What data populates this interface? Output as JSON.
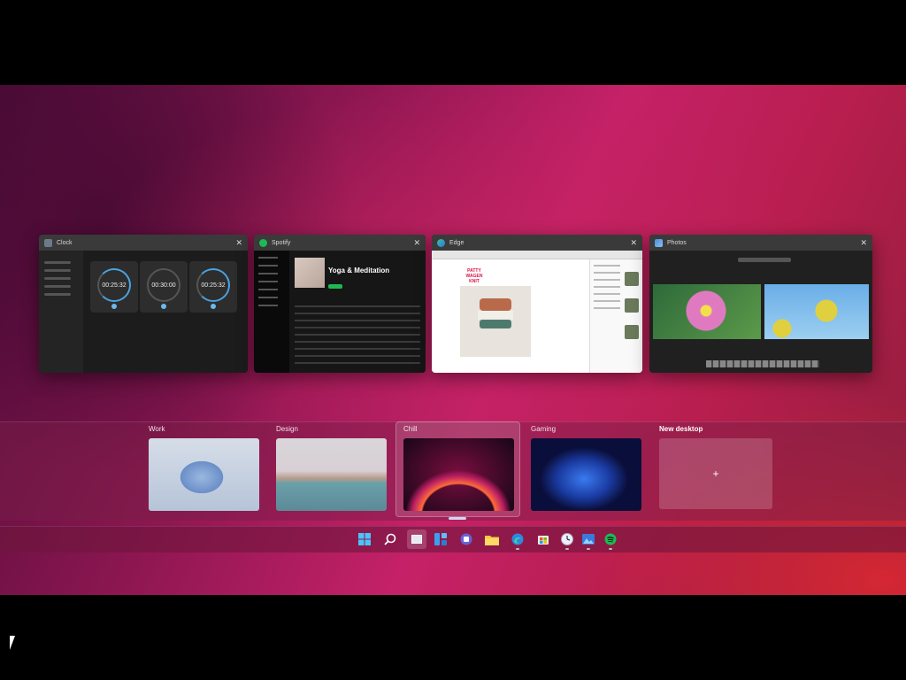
{
  "windows": [
    {
      "title": "Clock",
      "timers": [
        "00:25:32",
        "00:30:00",
        "00:25:32"
      ]
    },
    {
      "title": "Spotify",
      "playlist": "Yoga & Meditation"
    },
    {
      "title": "Edge",
      "logo": "PATTY WAGEN KNIT"
    },
    {
      "title": "Photos"
    }
  ],
  "desktops": [
    {
      "label": "Work"
    },
    {
      "label": "Design"
    },
    {
      "label": "Chill",
      "active": true
    },
    {
      "label": "Gaming"
    },
    {
      "label": "New desktop",
      "icon": "+"
    }
  ],
  "taskbar": {
    "icons": [
      "windows-start-icon",
      "search-icon",
      "task-view-icon",
      "widgets-icon",
      "teams-chat-icon",
      "edge-icon",
      "file-explorer-icon",
      "store-icon",
      "clock-app-icon",
      "photos-icon",
      "spotify-icon"
    ]
  },
  "colors": {
    "accent": "#4aa3e0",
    "spotify_green": "#1db954",
    "wallpaper": "#c52168"
  }
}
